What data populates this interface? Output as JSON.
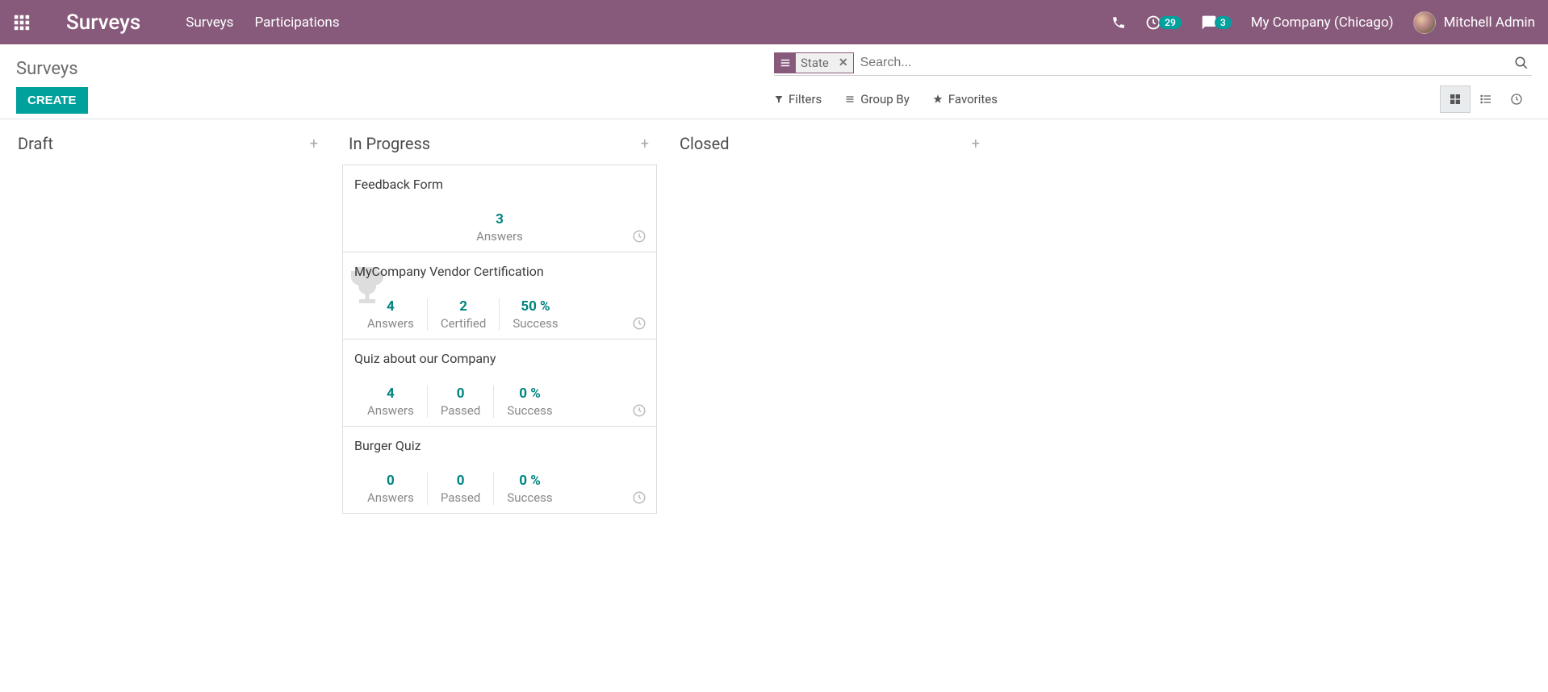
{
  "header": {
    "brand": "Surveys",
    "nav": [
      "Surveys",
      "Participations"
    ],
    "activities_badge": "29",
    "discuss_badge": "3",
    "company": "My Company (Chicago)",
    "user": "Mitchell Admin"
  },
  "breadcrumb": "Surveys",
  "create_label": "CREATE",
  "search": {
    "facet_label": "State",
    "placeholder": "Search..."
  },
  "toolbar": {
    "filters": "Filters",
    "groupby": "Group By",
    "favorites": "Favorites"
  },
  "columns": [
    {
      "title": "Draft",
      "cards": []
    },
    {
      "title": "In Progress",
      "cards": [
        {
          "title": "Feedback Form",
          "trophy": false,
          "stats": [
            {
              "value": "3",
              "label": "Answers"
            }
          ]
        },
        {
          "title": "MyCompany Vendor Certification",
          "trophy": true,
          "stats": [
            {
              "value": "4",
              "label": "Answers"
            },
            {
              "value": "2",
              "label": "Certified"
            },
            {
              "value": "50 %",
              "label": "Success"
            }
          ]
        },
        {
          "title": "Quiz about our Company",
          "trophy": false,
          "stats": [
            {
              "value": "4",
              "label": "Answers"
            },
            {
              "value": "0",
              "label": "Passed"
            },
            {
              "value": "0 %",
              "label": "Success"
            }
          ]
        },
        {
          "title": "Burger Quiz",
          "trophy": false,
          "stats": [
            {
              "value": "0",
              "label": "Answers"
            },
            {
              "value": "0",
              "label": "Passed"
            },
            {
              "value": "0 %",
              "label": "Success"
            }
          ]
        }
      ]
    },
    {
      "title": "Closed",
      "cards": []
    }
  ]
}
